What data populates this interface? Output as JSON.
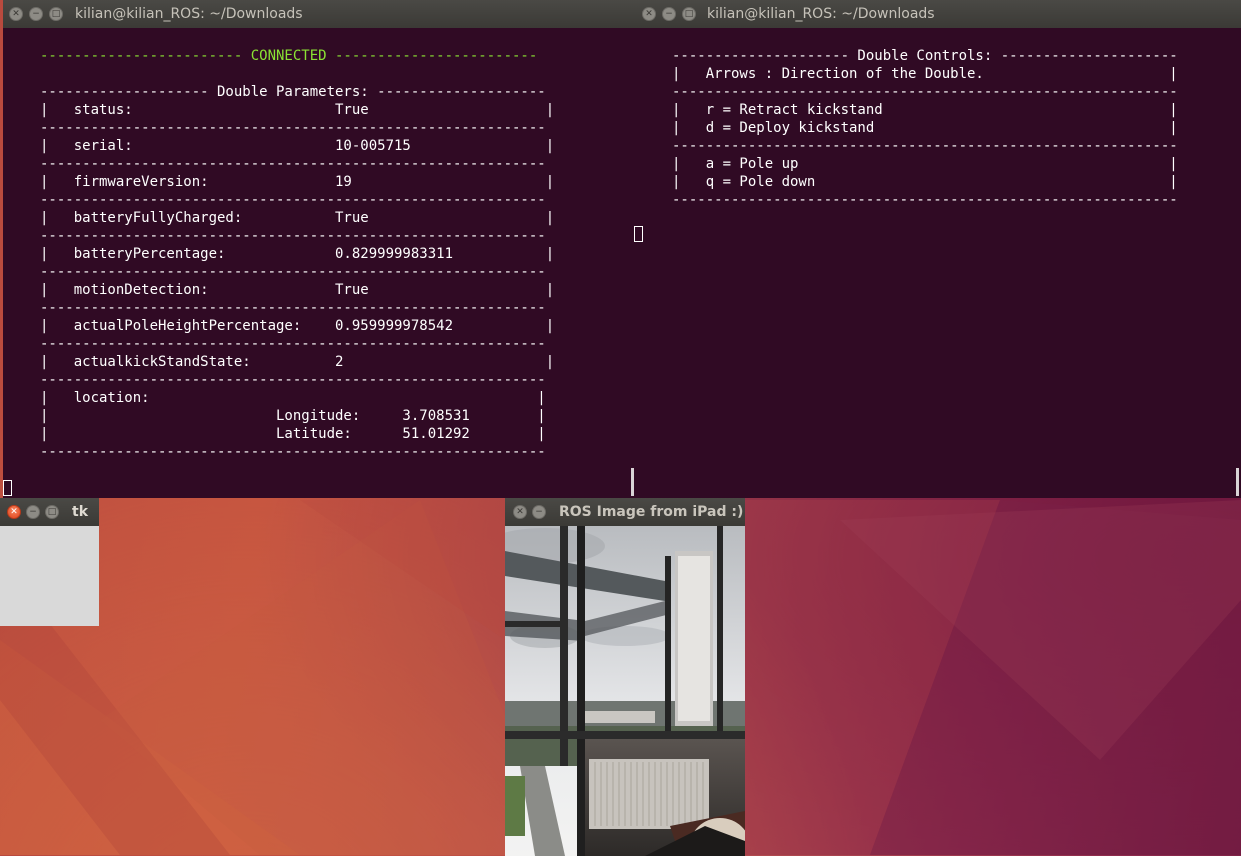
{
  "colors": {
    "terminal_bg": "#300a24",
    "terminal_fg": "#ffffff",
    "connected_green": "#8ae234",
    "titlebar_bg": "#3b3a36",
    "close_button_orange": "#e0441b",
    "tk_body": "#d9d9d9"
  },
  "icons": {
    "close": "close-icon",
    "minimize": "minimize-icon",
    "maximize": "maximize-icon"
  },
  "terminal_left": {
    "title": "kilian@kilian_ROS: ~/Downloads",
    "lines": [
      "------------------------ CONNECTED ------------------------",
      "",
      "-------------------- Double Parameters: --------------------",
      "|   status:                        True                     |",
      "------------------------------------------------------------",
      "|   serial:                        10-005715                |",
      "------------------------------------------------------------",
      "|   firmwareVersion:               19                       |",
      "------------------------------------------------------------",
      "|   batteryFullyCharged:           True                     |",
      "------------------------------------------------------------",
      "|   batteryPercentage:             0.829999983311           |",
      "------------------------------------------------------------",
      "|   motionDetection:               True                     |",
      "------------------------------------------------------------",
      "|   actualPoleHeightPercentage:    0.959999978542           |",
      "------------------------------------------------------------",
      "|   actualkickStandState:          2                        |",
      "------------------------------------------------------------",
      "|   location:                                              |",
      "|                           Longitude:     3.708531        |",
      "|                           Latitude:      51.01292        |",
      "------------------------------------------------------------"
    ]
  },
  "terminal_right": {
    "title": "kilian@kilian_ROS: ~/Downloads",
    "lines": [
      "--------------------- Double Controls: ---------------------",
      "|   Arrows : Direction of the Double.                      |",
      "------------------------------------------------------------",
      "|   r = Retract kickstand                                  |",
      "|   d = Deploy kickstand                                   |",
      "------------------------------------------------------------",
      "|   a = Pole up                                            |",
      "|   q = Pole down                                          |",
      "------------------------------------------------------------"
    ]
  },
  "tk_window": {
    "title": "tk"
  },
  "image_window": {
    "title": "ROS Image from iPad :)"
  }
}
